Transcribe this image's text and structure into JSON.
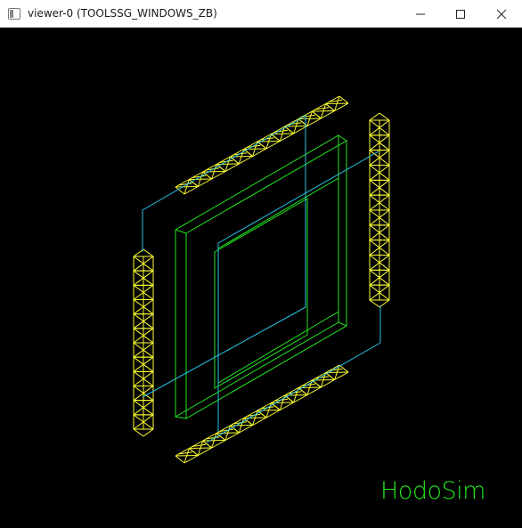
{
  "window": {
    "title": "viewer-0 (TOOLSSG_WINDOWS_ZB)",
    "controls": {
      "minimize_icon": "minimize-icon",
      "maximize_icon": "maximize-icon",
      "close_icon": "close-icon"
    }
  },
  "viewer": {
    "background": "#000000",
    "brand_text": "HodoSim",
    "colors": {
      "hodoscope_bars": "#ffff33",
      "frame": "#22e61e",
      "tracks": "#29c4e8",
      "brand": "#22e61e"
    },
    "scene": {
      "hodoscope_planes": 4,
      "segments_per_plane": 12,
      "frame": "green-square-frame",
      "tracks": 2
    }
  }
}
